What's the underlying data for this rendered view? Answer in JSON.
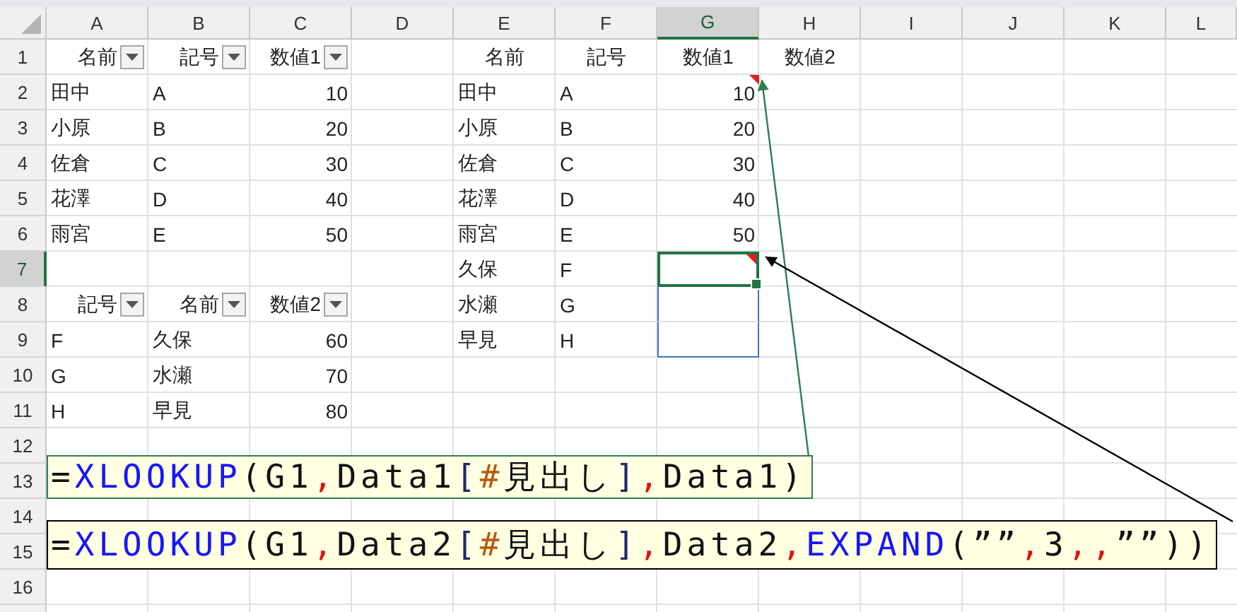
{
  "columns": [
    {
      "label": "A",
      "selected": false
    },
    {
      "label": "B",
      "selected": false
    },
    {
      "label": "C",
      "selected": false
    },
    {
      "label": "D",
      "selected": false
    },
    {
      "label": "E",
      "selected": false
    },
    {
      "label": "F",
      "selected": false
    },
    {
      "label": "G",
      "selected": true
    },
    {
      "label": "H",
      "selected": false
    },
    {
      "label": "I",
      "selected": false
    },
    {
      "label": "J",
      "selected": false
    },
    {
      "label": "K",
      "selected": false
    },
    {
      "label": "L",
      "selected": false
    }
  ],
  "rows": [
    {
      "number": "1",
      "selected": false,
      "cells": [
        {
          "text": "名前",
          "kind": "filter_header"
        },
        {
          "text": "記号",
          "kind": "filter_header"
        },
        {
          "text": "数値1",
          "kind": "filter_header"
        },
        null,
        {
          "text": "名前",
          "kind": "header"
        },
        {
          "text": "記号",
          "kind": "header"
        },
        {
          "text": "数値1",
          "kind": "header"
        },
        {
          "text": "数値2",
          "kind": "header"
        }
      ]
    },
    {
      "number": "2",
      "selected": false,
      "cells": [
        {
          "text": "田中",
          "kind": "text"
        },
        {
          "text": "A",
          "kind": "text"
        },
        {
          "text": "10",
          "kind": "number"
        },
        null,
        {
          "text": "田中",
          "kind": "text"
        },
        {
          "text": "A",
          "kind": "text"
        },
        {
          "text": "10",
          "kind": "number",
          "flag": true
        }
      ]
    },
    {
      "number": "3",
      "selected": false,
      "cells": [
        {
          "text": "小原",
          "kind": "text"
        },
        {
          "text": "B",
          "kind": "text"
        },
        {
          "text": "20",
          "kind": "number"
        },
        null,
        {
          "text": "小原",
          "kind": "text"
        },
        {
          "text": "B",
          "kind": "text"
        },
        {
          "text": "20",
          "kind": "number"
        }
      ]
    },
    {
      "number": "4",
      "selected": false,
      "cells": [
        {
          "text": "佐倉",
          "kind": "text"
        },
        {
          "text": "C",
          "kind": "text"
        },
        {
          "text": "30",
          "kind": "number"
        },
        null,
        {
          "text": "佐倉",
          "kind": "text"
        },
        {
          "text": "C",
          "kind": "text"
        },
        {
          "text": "30",
          "kind": "number"
        }
      ]
    },
    {
      "number": "5",
      "selected": false,
      "cells": [
        {
          "text": "花澤",
          "kind": "text"
        },
        {
          "text": "D",
          "kind": "text"
        },
        {
          "text": "40",
          "kind": "number"
        },
        null,
        {
          "text": "花澤",
          "kind": "text"
        },
        {
          "text": "D",
          "kind": "text"
        },
        {
          "text": "40",
          "kind": "number"
        }
      ]
    },
    {
      "number": "6",
      "selected": false,
      "cells": [
        {
          "text": "雨宮",
          "kind": "text"
        },
        {
          "text": "E",
          "kind": "text"
        },
        {
          "text": "50",
          "kind": "number"
        },
        null,
        {
          "text": "雨宮",
          "kind": "text"
        },
        {
          "text": "E",
          "kind": "text"
        },
        {
          "text": "50",
          "kind": "number"
        }
      ]
    },
    {
      "number": "7",
      "selected": true,
      "cells": [
        null,
        null,
        null,
        null,
        {
          "text": "久保",
          "kind": "text"
        },
        {
          "text": "F",
          "kind": "text"
        },
        {
          "kind": "active",
          "flag": true
        }
      ]
    },
    {
      "number": "8",
      "selected": false,
      "cells": [
        {
          "text": "記号",
          "kind": "filter_header"
        },
        {
          "text": "名前",
          "kind": "filter_header"
        },
        {
          "text": "数値2",
          "kind": "filter_header"
        },
        null,
        {
          "text": "水瀬",
          "kind": "text"
        },
        {
          "text": "G",
          "kind": "text"
        },
        {
          "kind": "spill"
        }
      ]
    },
    {
      "number": "9",
      "selected": false,
      "cells": [
        {
          "text": "F",
          "kind": "text"
        },
        {
          "text": "久保",
          "kind": "text"
        },
        {
          "text": "60",
          "kind": "number"
        },
        null,
        {
          "text": "早見",
          "kind": "text"
        },
        {
          "text": "H",
          "kind": "text"
        },
        {
          "kind": "spill_end"
        }
      ]
    },
    {
      "number": "10",
      "selected": false,
      "cells": [
        {
          "text": "G",
          "kind": "text"
        },
        {
          "text": "水瀬",
          "kind": "text"
        },
        {
          "text": "70",
          "kind": "number"
        }
      ]
    },
    {
      "number": "11",
      "selected": false,
      "cells": [
        {
          "text": "H",
          "kind": "text"
        },
        {
          "text": "早見",
          "kind": "text"
        },
        {
          "text": "80",
          "kind": "number"
        }
      ]
    },
    {
      "number": "12",
      "selected": false,
      "cells": []
    },
    {
      "number": "13",
      "selected": false,
      "cells": []
    },
    {
      "number": "14",
      "selected": false,
      "cells": []
    },
    {
      "number": "15",
      "selected": false,
      "cells": []
    },
    {
      "number": "16",
      "selected": false,
      "cells": []
    }
  ],
  "callouts": [
    {
      "color": "#2e7d4f",
      "tokens": [
        {
          "text": "=",
          "kind": "plain"
        },
        {
          "text": "XLOOKUP",
          "kind": "function"
        },
        {
          "text": "(G1",
          "kind": "plain"
        },
        {
          "text": ",",
          "kind": "separator"
        },
        {
          "text": "Data1",
          "kind": "plain"
        },
        {
          "text": "[",
          "kind": "bracket"
        },
        {
          "text": "#",
          "kind": "special"
        },
        {
          "text": "見出し",
          "kind": "plain"
        },
        {
          "text": "]",
          "kind": "bracket"
        },
        {
          "text": ",",
          "kind": "separator"
        },
        {
          "text": "Data1)",
          "kind": "plain"
        }
      ]
    },
    {
      "color": "#000000",
      "tokens": [
        {
          "text": "=",
          "kind": "plain"
        },
        {
          "text": "XLOOKUP",
          "kind": "function"
        },
        {
          "text": "(G1",
          "kind": "plain"
        },
        {
          "text": ",",
          "kind": "separator"
        },
        {
          "text": "Data2",
          "kind": "plain"
        },
        {
          "text": "[",
          "kind": "bracket"
        },
        {
          "text": "#",
          "kind": "special"
        },
        {
          "text": "見出し",
          "kind": "plain"
        },
        {
          "text": "]",
          "kind": "bracket"
        },
        {
          "text": ",",
          "kind": "separator"
        },
        {
          "text": "Data2",
          "kind": "plain"
        },
        {
          "text": ",",
          "kind": "separator"
        },
        {
          "text": "EXPAND",
          "kind": "function"
        },
        {
          "text": "(””",
          "kind": "plain"
        },
        {
          "text": ",",
          "kind": "separator"
        },
        {
          "text": "3",
          "kind": "plain"
        },
        {
          "text": ",",
          "kind": "separator"
        },
        {
          "text": ",",
          "kind": "separator"
        },
        {
          "text": "””))",
          "kind": "plain"
        }
      ]
    }
  ]
}
